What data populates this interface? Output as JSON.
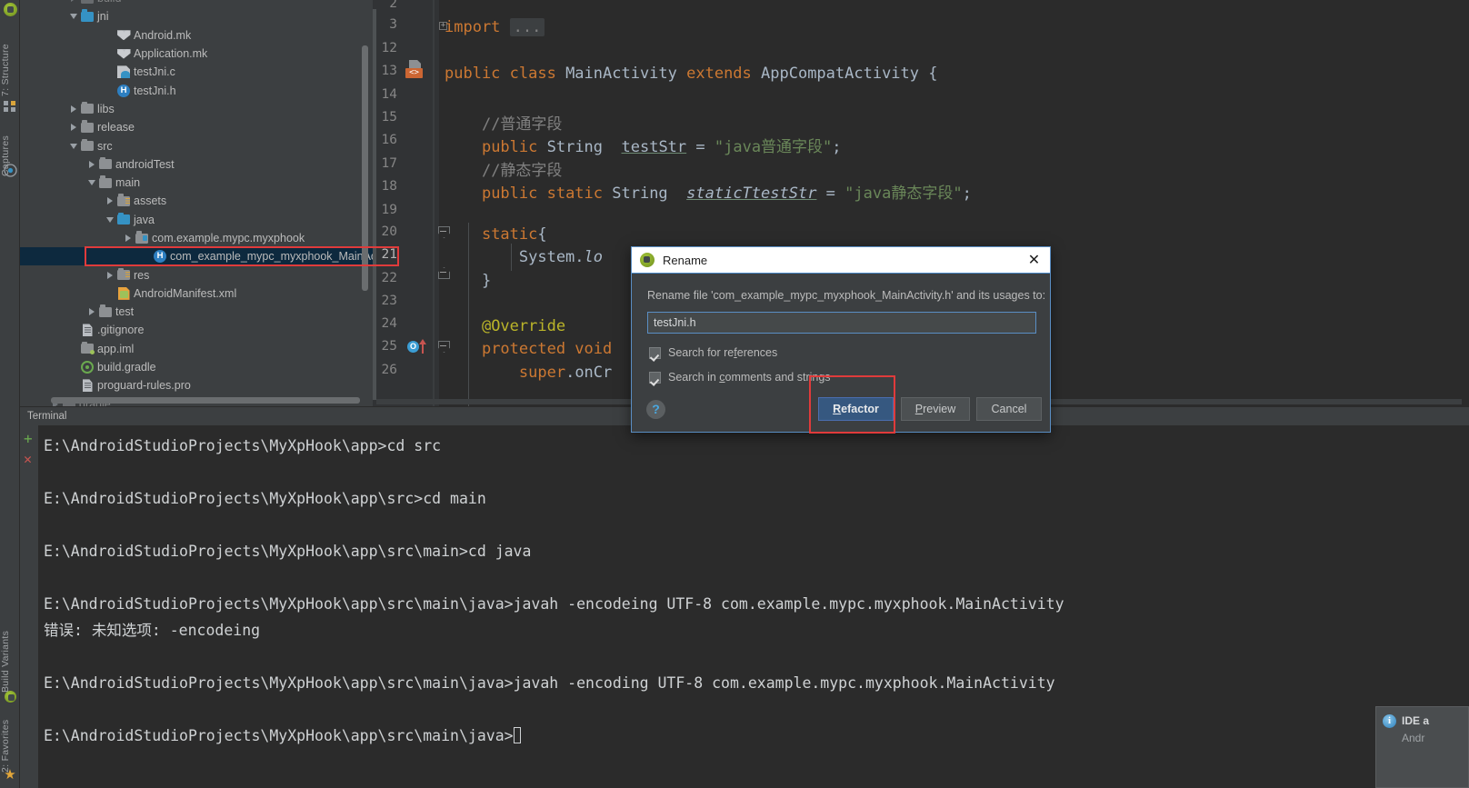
{
  "tool_strip": {
    "top_icon": "android-icon",
    "tabs": [
      {
        "label": "7: Structure",
        "icon": "structure-icon"
      },
      {
        "label": "Captures",
        "icon": "captures-icon"
      }
    ],
    "bottom_tabs": [
      {
        "label": "Build Variants",
        "icon": "android-icon"
      },
      {
        "label": "2: Favorites",
        "icon": "star-icon"
      }
    ]
  },
  "project_tree": {
    "items": [
      {
        "label": "build",
        "icon": "folder-icon",
        "indent": 2,
        "twisty": "collapsed",
        "clipped": true
      },
      {
        "label": "jni",
        "icon": "folder-blue-icon",
        "indent": 2,
        "twisty": "expanded"
      },
      {
        "label": "Android.mk",
        "icon": "makefile-icon",
        "indent": 4,
        "twisty": "none"
      },
      {
        "label": "Application.mk",
        "icon": "makefile-icon",
        "indent": 4,
        "twisty": "none"
      },
      {
        "label": "testJni.c",
        "icon": "c-file-icon",
        "indent": 4,
        "twisty": "none"
      },
      {
        "label": "testJni.h",
        "icon": "h-file-icon",
        "indent": 4,
        "twisty": "none"
      },
      {
        "label": "libs",
        "icon": "folder-icon",
        "indent": 2,
        "twisty": "collapsed"
      },
      {
        "label": "release",
        "icon": "folder-icon",
        "indent": 2,
        "twisty": "collapsed"
      },
      {
        "label": "src",
        "icon": "folder-icon",
        "indent": 2,
        "twisty": "expanded"
      },
      {
        "label": "androidTest",
        "icon": "folder-icon",
        "indent": 3,
        "twisty": "collapsed"
      },
      {
        "label": "main",
        "icon": "folder-icon",
        "indent": 3,
        "twisty": "expanded"
      },
      {
        "label": "assets",
        "icon": "folder-res-icon",
        "indent": 4,
        "twisty": "collapsed"
      },
      {
        "label": "java",
        "icon": "folder-blue-icon",
        "indent": 4,
        "twisty": "expanded"
      },
      {
        "label": "com.example.mypc.myxphook",
        "icon": "package-icon",
        "indent": 5,
        "twisty": "collapsed"
      },
      {
        "label": "com_example_mypc_myxphook_MainActivity.h",
        "icon": "h-file-icon",
        "indent": 6,
        "twisty": "none",
        "selected": true
      },
      {
        "label": "res",
        "icon": "folder-res-icon",
        "indent": 4,
        "twisty": "collapsed"
      },
      {
        "label": "AndroidManifest.xml",
        "icon": "xml-file-icon",
        "indent": 4,
        "twisty": "none"
      },
      {
        "label": "test",
        "icon": "folder-icon",
        "indent": 3,
        "twisty": "collapsed"
      },
      {
        "label": ".gitignore",
        "icon": "text-file-icon",
        "indent": 2,
        "twisty": "none"
      },
      {
        "label": "app.iml",
        "icon": "module-icon",
        "indent": 2,
        "twisty": "none"
      },
      {
        "label": "build.gradle",
        "icon": "gradle-file-icon",
        "indent": 2,
        "twisty": "none"
      },
      {
        "label": "proguard-rules.pro",
        "icon": "text-file-icon",
        "indent": 2,
        "twisty": "none"
      },
      {
        "label": "gradle",
        "icon": "folder-icon",
        "indent": 1,
        "twisty": "collapsed",
        "clipped": true
      }
    ]
  },
  "editor": {
    "line_numbers": [
      "2",
      "3",
      "12",
      "13",
      "14",
      "15",
      "16",
      "17",
      "18",
      "19",
      "20",
      "21",
      "22",
      "23",
      "24",
      "25",
      "26"
    ],
    "code_lines": [
      {
        "n": "3",
        "html": "<span class=\"k\">import</span> <span class=\"dots\">...</span>"
      },
      {
        "n": "13",
        "html": "<span class=\"k\">public class</span> MainActivity <span class=\"k\">extends</span> AppCompatActivity {"
      },
      {
        "n": "15",
        "html": "    <span class=\"cm\">//普通字段</span>"
      },
      {
        "n": "16",
        "html": "    <span class=\"k\">public</span> String  <span class=\"fd\">testStr</span> = <span class=\"st\">\"java普通字段\"</span>;"
      },
      {
        "n": "17",
        "html": "    <span class=\"cm\">//静态字段</span>"
      },
      {
        "n": "18",
        "html": "    <span class=\"k\">public static</span> String  <span class=\"fd it\">staticTtestStr</span> = <span class=\"st\">\"java静态字段\"</span>;"
      },
      {
        "n": "20",
        "html": "    <span class=\"k\">static</span>{"
      },
      {
        "n": "21",
        "html": "        System.<span class=\"it\">lo</span>"
      },
      {
        "n": "22",
        "html": "    }"
      },
      {
        "n": "24",
        "html": "    <span class=\"an\">@Override</span>"
      },
      {
        "n": "25",
        "html": "    <span class=\"k\">protected void</span>"
      },
      {
        "n": "26",
        "html": "        <span class=\"k\">super</span>.onCr"
      }
    ]
  },
  "terminal": {
    "tab_label": "Terminal",
    "new_session_icon": "plus-icon",
    "close_session_icon": "close-x-icon",
    "lines": [
      "E:\\AndroidStudioProjects\\MyXpHook\\app>cd src",
      "E:\\AndroidStudioProjects\\MyXpHook\\app\\src>cd main",
      "E:\\AndroidStudioProjects\\MyXpHook\\app\\src\\main>cd java",
      "E:\\AndroidStudioProjects\\MyXpHook\\app\\src\\main\\java>javah -encodeing UTF-8 com.example.mypc.myxphook.MainActivity",
      "错误: 未知选项: -encodeing",
      "E:\\AndroidStudioProjects\\MyXpHook\\app\\src\\main\\java>javah -encoding UTF-8 com.example.mypc.myxphook.MainActivity",
      "E:\\AndroidStudioProjects\\MyXpHook\\app\\src\\main\\java>"
    ]
  },
  "rename_dialog": {
    "icon": "android-icon",
    "title": "Rename",
    "close_icon": "close-x-icon",
    "prompt": "Rename file 'com_example_mypc_myxphook_MainActivity.h' and its usages to:",
    "input_value": "testJni.h",
    "input_placeholder": "",
    "checkboxes": [
      {
        "label_pre": "Search for re",
        "label_key": "f",
        "label_post": "erences",
        "checked": true
      },
      {
        "label_pre": "Search in ",
        "label_key": "c",
        "label_post": "omments and strings",
        "checked": true
      }
    ],
    "help_label": "?",
    "buttons": [
      {
        "label_pre": "",
        "label_key": "R",
        "label_post": "efactor",
        "kind": "default"
      },
      {
        "label_pre": "",
        "label_key": "P",
        "label_post": "review",
        "kind": "normal"
      },
      {
        "label_pre": "Cancel",
        "label_key": "",
        "label_post": "",
        "kind": "normal"
      }
    ]
  },
  "notification": {
    "icon": "info-icon",
    "title": "IDE a",
    "body": "Andr"
  },
  "colors": {
    "ide_bg": "#3c3f41",
    "editor_bg": "#2b2b2b",
    "selection": "#0d293e",
    "accent_blue": "#4b6eaf",
    "highlight_red": "#e03b3b",
    "keyword_orange": "#cc7832",
    "string_green": "#6a8759",
    "annotation_yellow": "#bbb529",
    "comment_gray": "#808080"
  }
}
